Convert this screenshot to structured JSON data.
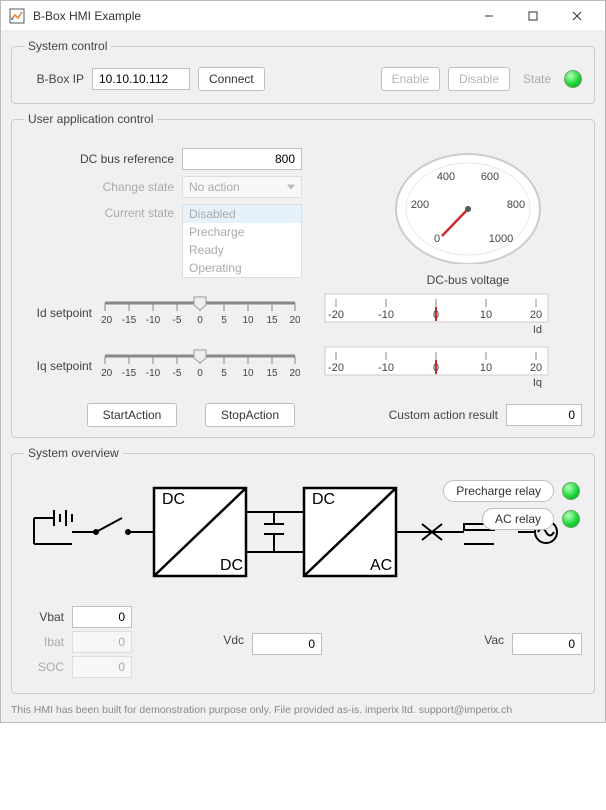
{
  "window": {
    "title": "B-Box HMI Example"
  },
  "system_control": {
    "legend": "System control",
    "ip_label": "B-Box IP",
    "ip_value": "10.10.10.112",
    "connect": "Connect",
    "enable": "Enable",
    "disable": "Disable",
    "state": "State"
  },
  "user_app": {
    "legend": "User application control",
    "dc_ref_label": "DC bus reference",
    "dc_ref_value": "800",
    "change_state_label": "Change state",
    "change_state_value": "No action",
    "current_state_label": "Current state",
    "state_options": [
      "Disabled",
      "Precharge",
      "Ready",
      "Operating"
    ],
    "state_selected_index": 0,
    "gauge_caption": "DC-bus voltage",
    "gauge_ticks": [
      "0",
      "200",
      "400",
      "600",
      "800",
      "1000"
    ],
    "gauge_value": 0,
    "id_label": "Id setpoint",
    "iq_label": "Iq setpoint",
    "slider_ticks": [
      "-20",
      "-15",
      "-10",
      "-5",
      "0",
      "5",
      "10",
      "15",
      "20"
    ],
    "slider_id_value": 0,
    "slider_iq_value": 0,
    "meter_id_label": "Id",
    "meter_iq_label": "Iq",
    "meter_ticks": [
      "-20",
      "-10",
      "0",
      "10",
      "20"
    ],
    "meter_id_value": 0,
    "meter_iq_value": 0,
    "start_action": "StartAction",
    "stop_action": "StopAction",
    "custom_result_label": "Custom action result",
    "custom_result_value": "0"
  },
  "overview": {
    "legend": "System overview",
    "precharge_relay": "Precharge relay",
    "ac_relay": "AC relay",
    "dc_label": "DC",
    "ac_label": "AC",
    "vbat_label": "Vbat",
    "vbat_value": "0",
    "ibat_label": "Ibat",
    "ibat_value": "0",
    "soc_label": "SOC",
    "soc_value": "0",
    "vdc_label": "Vdc",
    "vdc_value": "0",
    "vac_label": "Vac",
    "vac_value": "0"
  },
  "footer": "This HMI has been built for demonstration purpose only. File provided as-is. imperix ltd. support@imperix.ch"
}
